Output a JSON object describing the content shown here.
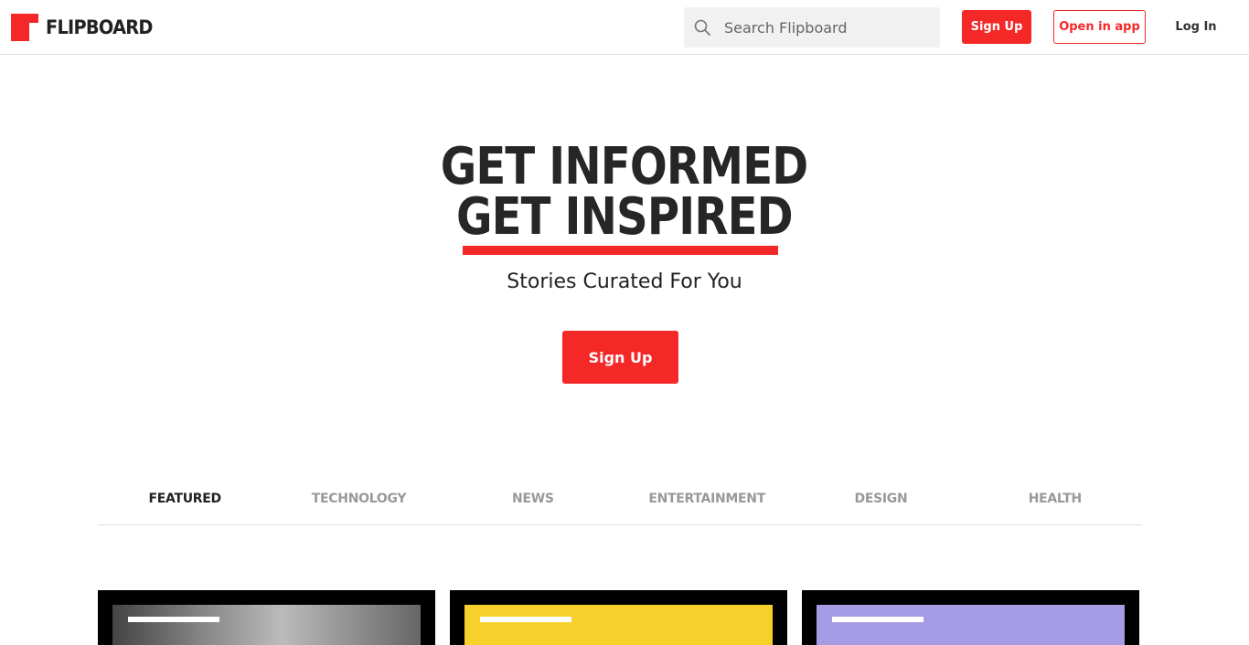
{
  "header": {
    "logo_text": "FLIPBOARD",
    "search": {
      "placeholder": "Search Flipboard",
      "value": ""
    },
    "signup_label": "Sign Up",
    "open_app_label": "Open in app",
    "login_label": "Log In"
  },
  "hero": {
    "line1": "GET INFORMED",
    "line2": "GET INSPIRED",
    "subtitle": "Stories Curated For You",
    "signup_label": "Sign Up"
  },
  "tabs": [
    {
      "label": "FEATURED",
      "active": true
    },
    {
      "label": "TECHNOLOGY",
      "active": false
    },
    {
      "label": "NEWS",
      "active": false
    },
    {
      "label": "ENTERTAINMENT",
      "active": false
    },
    {
      "label": "DESIGN",
      "active": false
    },
    {
      "label": "HEALTH",
      "active": false
    }
  ],
  "colors": {
    "brand": "#f52828",
    "text": "#222222",
    "muted": "#999999"
  },
  "icons": {
    "search": "search-icon",
    "logo": "flipboard-logo-icon"
  }
}
